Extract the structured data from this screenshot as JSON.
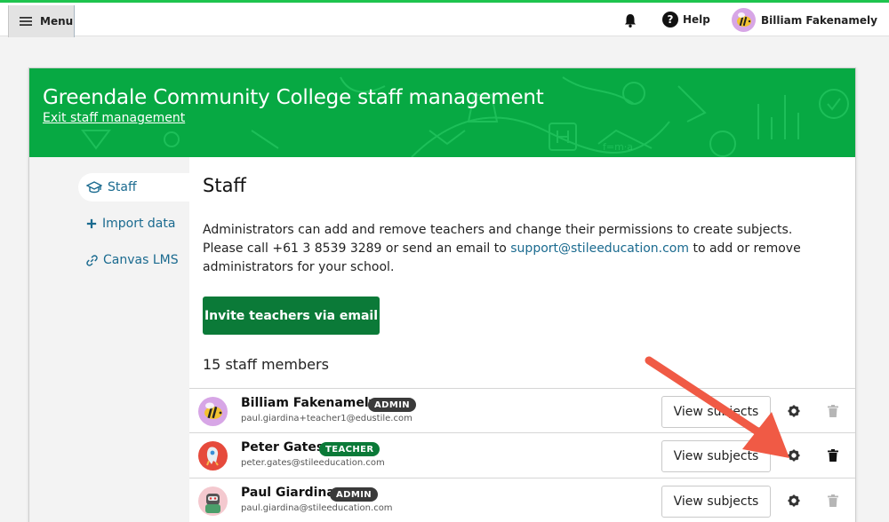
{
  "topbar": {
    "menu_label": "Menu",
    "help_label": "Help",
    "user_name": "Billiam Fakenamely",
    "accent_color": "#1ec44e"
  },
  "banner": {
    "title": "Greendale Community College staff management",
    "exit_link": "Exit staff management",
    "color": "#07a943"
  },
  "sidebar": {
    "items": [
      {
        "label": "Staff",
        "icon": "graduation-cap-icon",
        "active": true
      },
      {
        "label": "Import data",
        "icon": "plus-icon",
        "active": false
      },
      {
        "label": "Canvas LMS",
        "icon": "link-icon",
        "active": false
      }
    ]
  },
  "main": {
    "title": "Staff",
    "desc_part1": "Administrators can add and remove teachers and change their permissions to create subjects. Please call +61 3 8539 3289 or send an email to ",
    "desc_link": "support@stileeducation.com",
    "desc_part2": " to add or remove administrators for your school.",
    "invite_button": "Invite teachers via email",
    "staff_count": "15 staff members"
  },
  "staff": [
    {
      "name": "Billiam Fakenamely",
      "role": "ADMIN",
      "email": "paul.giardina+teacher1@edustile.com",
      "view_label": "View subjects"
    },
    {
      "name": "Peter Gates",
      "role": "TEACHER",
      "email": "peter.gates@stileeducation.com",
      "view_label": "View subjects"
    },
    {
      "name": "Paul Giardina",
      "role": "ADMIN",
      "email": "paul.giardina@stileeducation.com",
      "view_label": "View subjects"
    }
  ],
  "colors": {
    "primary_button": "#0b7a38",
    "link": "#1a6a8f",
    "annotation_arrow": "#f05a45"
  }
}
